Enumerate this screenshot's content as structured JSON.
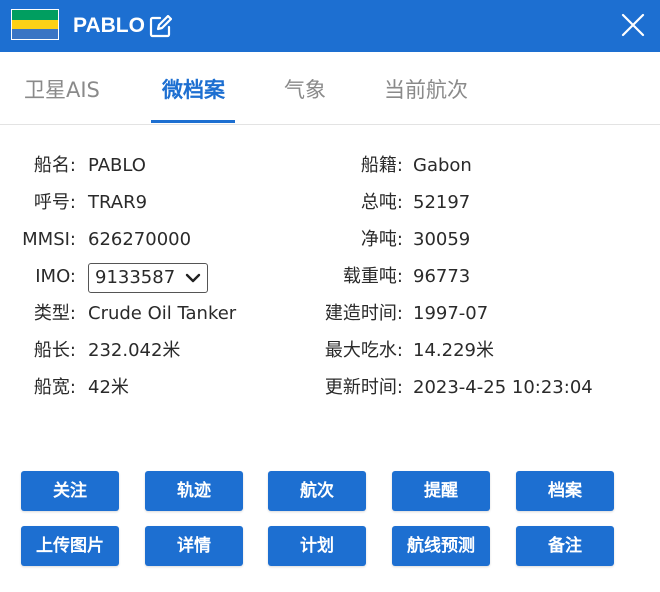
{
  "header": {
    "ship_name": "PABLO",
    "bg_color": "#1d6fd1",
    "flag_colors": [
      "#009e60",
      "#fcd116",
      "#3a75c4"
    ],
    "edit_icon": "edit-icon",
    "close_icon": "close-icon"
  },
  "tabs": [
    {
      "label": "卫星AIS",
      "active": false
    },
    {
      "label": "微档案",
      "active": true
    },
    {
      "label": "气象",
      "active": false
    },
    {
      "label": "当前航次",
      "active": false
    }
  ],
  "info": {
    "ship_name_label": "船名:",
    "ship_name_value": "PABLO",
    "callsign_label": "呼号:",
    "callsign_value": "TRAR9",
    "mmsi_label": "MMSI:",
    "mmsi_value": "626270000",
    "imo_label": "IMO:",
    "imo_value": "9133587",
    "type_label": "类型:",
    "type_value": "Crude Oil Tanker",
    "length_label": "船长:",
    "length_value": "232.042米",
    "width_label": "船宽:",
    "width_value": "42米",
    "flag_label": "船籍:",
    "flag_value": "Gabon",
    "gross_label": "总吨:",
    "gross_value": "52197",
    "net_label": "净吨:",
    "net_value": "30059",
    "dwt_label": "载重吨:",
    "dwt_value": "96773",
    "built_label": "建造时间:",
    "built_value": "1997-07",
    "draft_label": "最大吃水:",
    "draft_value": "14.229米",
    "updated_label": "更新时间:",
    "updated_value": "2023-4-25 10:23:04"
  },
  "buttons": {
    "follow": "关注",
    "track": "轨迹",
    "voyage": "航次",
    "remind": "提醒",
    "archive": "档案",
    "upload": "上传图片",
    "details": "详情",
    "plan": "计划",
    "route_predict": "航线预测",
    "note": "备注"
  }
}
